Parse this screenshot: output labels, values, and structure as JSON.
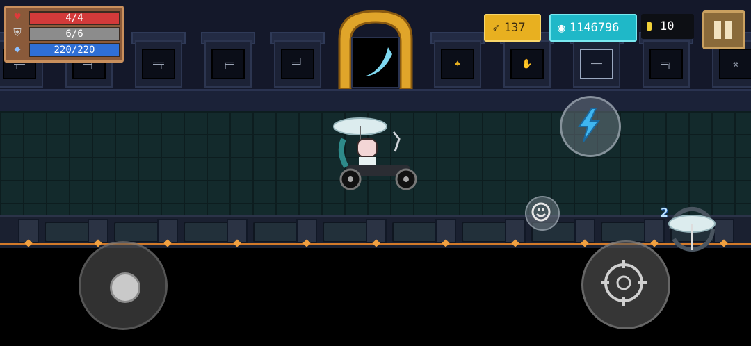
{
  "hud": {
    "hp": {
      "icon": "heart-icon",
      "text": "4/4",
      "fill": 1.0,
      "color": "#d23a3a"
    },
    "armor": {
      "icon": "shield-icon",
      "text": "6/6",
      "fill": 1.0,
      "color": "#8c8c8c"
    },
    "energy": {
      "icon": "diamond-icon",
      "text": "220/220",
      "fill": 1.0,
      "color": "#2f6fd6"
    }
  },
  "currency": {
    "gems": {
      "icon": "feather-icon",
      "value": "137"
    },
    "crystals": {
      "icon": "crystal-eye-icon",
      "value": "1146796"
    },
    "coins": {
      "icon": "coin-icon",
      "value": "10"
    }
  },
  "controls": {
    "pause_icon": "pause-icon",
    "skill_icon": "lightning-icon",
    "emote_icon": "smiley-icon",
    "aim_icon": "crosshair-icon",
    "weapon_swap_count": "2",
    "weapon_swap_icon": "umbrella-icon"
  },
  "weapon_rack": [
    "rifle-icon",
    "pistol-icon",
    "shotgun-icon",
    "blaster-icon",
    "gun-icon",
    "portal-icon",
    "lamp-icon",
    "gauntlet-icon",
    "sword-icon",
    "revolver-icon",
    "staff-icon"
  ],
  "colors": {
    "floor": "#132a2c",
    "accent_orange": "#d27a2a",
    "arch_gold": "#e0a52a"
  }
}
